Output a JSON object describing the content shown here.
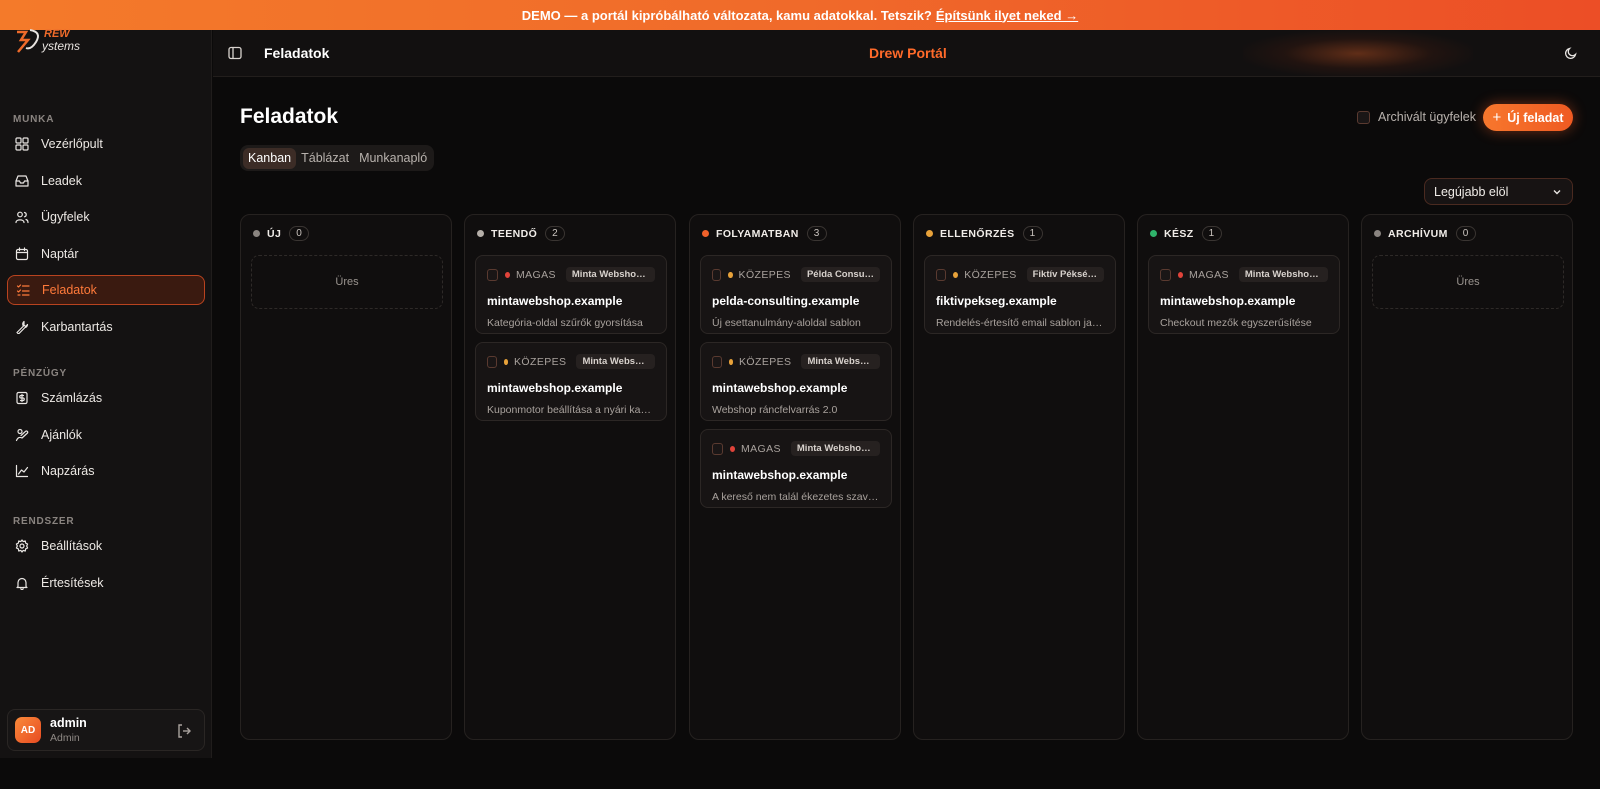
{
  "banner": {
    "text": "DEMO — a portál kipróbálható változata, kamu adatokkal. Tetszik?",
    "link": "Építsünk ilyet neked →"
  },
  "sidebar": {
    "sections": [
      {
        "label": "MUNKA",
        "items": [
          "Vezérlőpult",
          "Leadek",
          "Ügyfelek",
          "Naptár",
          "Feladatok",
          "Karbantartás"
        ]
      },
      {
        "label": "PÉNZÜGY",
        "items": [
          "Számlázás",
          "Ajánlók",
          "Napzárás"
        ]
      },
      {
        "label": "RENDSZER",
        "items": [
          "Beállítások",
          "Értesítések"
        ]
      }
    ],
    "active": "Feladatok",
    "user": {
      "initials": "AD",
      "name": "admin",
      "role": "Admin"
    }
  },
  "topbar": {
    "title": "Feladatok",
    "brand": "Drew Portál"
  },
  "page": {
    "title": "Feladatok",
    "tabs": [
      "Kanban",
      "Táblázat",
      "Munkanapló"
    ],
    "active_tab": "Kanban",
    "archived_label": "Archivált ügyfelek",
    "new_button": "Új feladat",
    "sort": "Legújabb elöl"
  },
  "colors": {
    "accent": "#f26a2a",
    "high": "#e0433a",
    "medium": "#e8a23a",
    "done": "#2fb36a",
    "gray": "#8a8480"
  },
  "board": {
    "columns": [
      {
        "name": "ÚJ",
        "count": "0",
        "dot": "#8a8480",
        "empty": "Üres",
        "cards": []
      },
      {
        "name": "TEENDŐ",
        "count": "2",
        "dot": "#b5afa9",
        "cards": [
          {
            "priority": "MAGAS",
            "pcolor": "#e0433a",
            "client": "Minta Webshop Kft.",
            "title": "mintawebshop.example",
            "desc": "Kategória-oldal szűrők gyorsítása"
          },
          {
            "priority": "KÖZEPES",
            "pcolor": "#e8a23a",
            "client": "Minta Webshop Kft.",
            "title": "mintawebshop.example",
            "desc": "Kuponmotor beállítása a nyári kampányhoz"
          }
        ]
      },
      {
        "name": "FOLYAMATBAN",
        "count": "3",
        "dot": "#f0612a",
        "cards": [
          {
            "priority": "KÖZEPES",
            "pcolor": "#e8a23a",
            "client": "Példa Consulting Bt.",
            "title": "pelda-consulting.example",
            "desc": "Új esettanulmány-aloldal sablon"
          },
          {
            "priority": "KÖZEPES",
            "pcolor": "#e8a23a",
            "client": "Minta Webshop Kft.",
            "title": "mintawebshop.example",
            "desc": "Webshop ráncfelvarrás 2.0"
          },
          {
            "priority": "MAGAS",
            "pcolor": "#e0433a",
            "client": "Minta Webshop Kft.",
            "title": "mintawebshop.example",
            "desc": "A kereső nem talál ékezetes szavakra"
          }
        ]
      },
      {
        "name": "ELLENŐRZÉS",
        "count": "1",
        "dot": "#e8a23a",
        "cards": [
          {
            "priority": "KÖZEPES",
            "pcolor": "#e8a23a",
            "client": "Fiktív Pékség Kft.",
            "title": "fiktivpekseg.example",
            "desc": "Rendelés-értesítő email sablon javítása"
          }
        ]
      },
      {
        "name": "KÉSZ",
        "count": "1",
        "dot": "#2fb36a",
        "cards": [
          {
            "priority": "MAGAS",
            "pcolor": "#e0433a",
            "client": "Minta Webshop Kft.",
            "title": "mintawebshop.example",
            "desc": "Checkout mezők egyszerűsítése"
          }
        ]
      },
      {
        "name": "ARCHÍVUM",
        "count": "0",
        "dot": "#8a8480",
        "empty": "Üres",
        "cards": []
      }
    ]
  }
}
